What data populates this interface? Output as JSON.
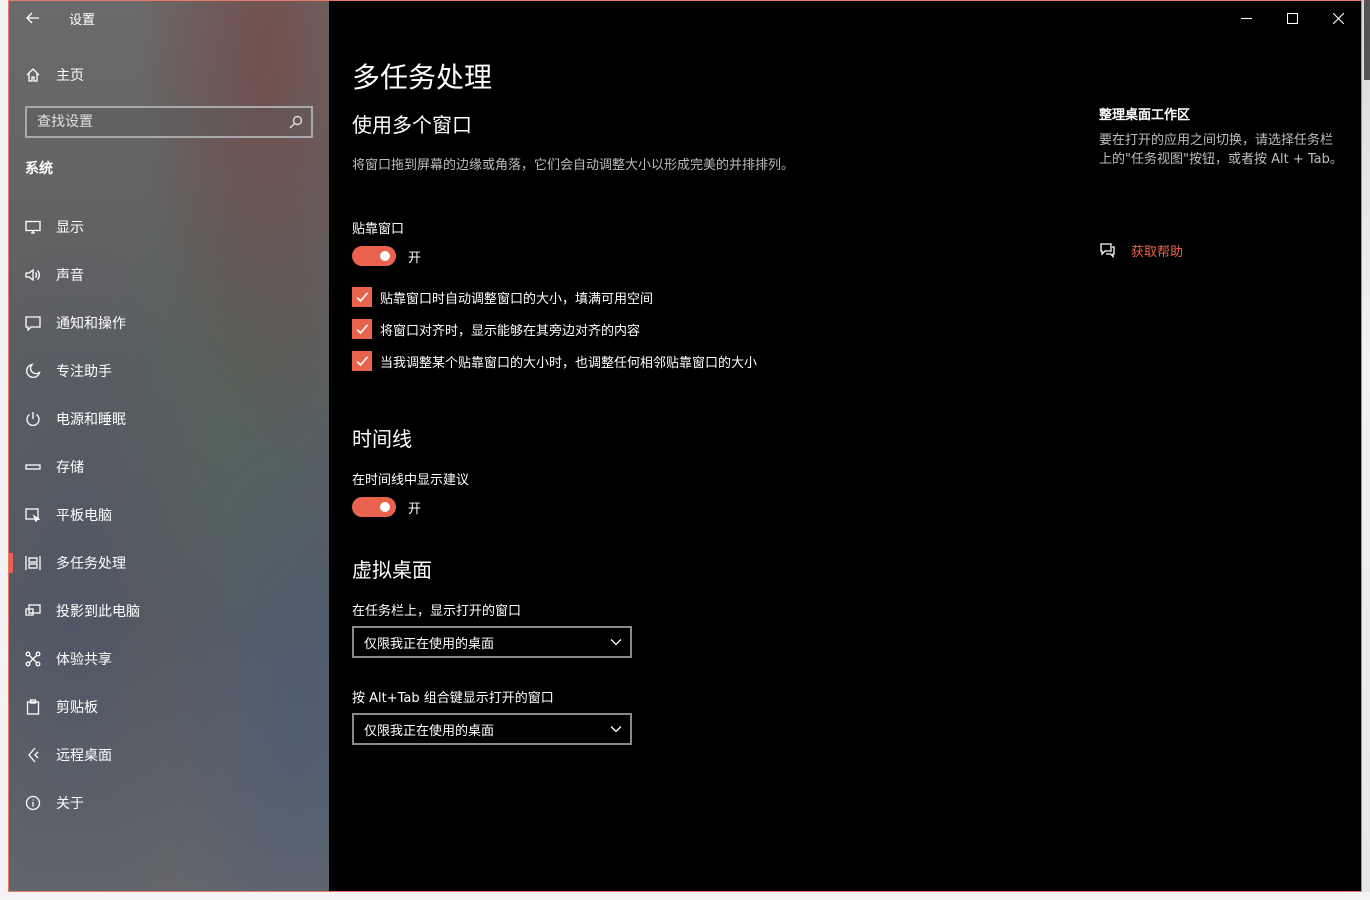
{
  "app": {
    "title": "设置"
  },
  "colors": {
    "accent": "#e8624e",
    "border": "#e57a6a"
  },
  "sidebar": {
    "home_label": "主页",
    "search_placeholder": "查找设置",
    "section": "系统",
    "items": [
      {
        "label": "显示",
        "icon": "monitor-icon"
      },
      {
        "label": "声音",
        "icon": "speaker-icon"
      },
      {
        "label": "通知和操作",
        "icon": "notification-icon"
      },
      {
        "label": "专注助手",
        "icon": "moon-icon"
      },
      {
        "label": "电源和睡眠",
        "icon": "power-icon"
      },
      {
        "label": "存储",
        "icon": "storage-icon"
      },
      {
        "label": "平板电脑",
        "icon": "tablet-icon"
      },
      {
        "label": "多任务处理",
        "icon": "multitask-icon",
        "active": true
      },
      {
        "label": "投影到此电脑",
        "icon": "project-icon"
      },
      {
        "label": "体验共享",
        "icon": "share-icon"
      },
      {
        "label": "剪贴板",
        "icon": "clipboard-icon"
      },
      {
        "label": "远程桌面",
        "icon": "remote-icon"
      },
      {
        "label": "关于",
        "icon": "info-icon"
      }
    ]
  },
  "main": {
    "title": "多任务处理",
    "snap": {
      "heading": "使用多个窗口",
      "description": "将窗口拖到屏幕的边缘或角落，它们会自动调整大小以形成完美的并排排列。",
      "toggle_label": "贴靠窗口",
      "toggle_state": "开",
      "checks": [
        "贴靠窗口时自动调整窗口的大小，填满可用空间",
        "将窗口对齐时，显示能够在其旁边对齐的内容",
        "当我调整某个贴靠窗口的大小时，也调整任何相邻贴靠窗口的大小"
      ]
    },
    "timeline": {
      "heading": "时间线",
      "toggle_label": "在时间线中显示建议",
      "toggle_state": "开"
    },
    "virtual": {
      "heading": "虚拟桌面",
      "taskbar_label": "在任务栏上，显示打开的窗口",
      "taskbar_value": "仅限我正在使用的桌面",
      "alttab_label": "按 Alt+Tab 组合键显示打开的窗口",
      "alttab_value": "仅限我正在使用的桌面"
    }
  },
  "aside": {
    "title": "整理桌面工作区",
    "description": "要在打开的应用之间切换，请选择任务栏上的\"任务视图\"按钮，或者按 Alt + Tab。",
    "help": "获取帮助"
  }
}
